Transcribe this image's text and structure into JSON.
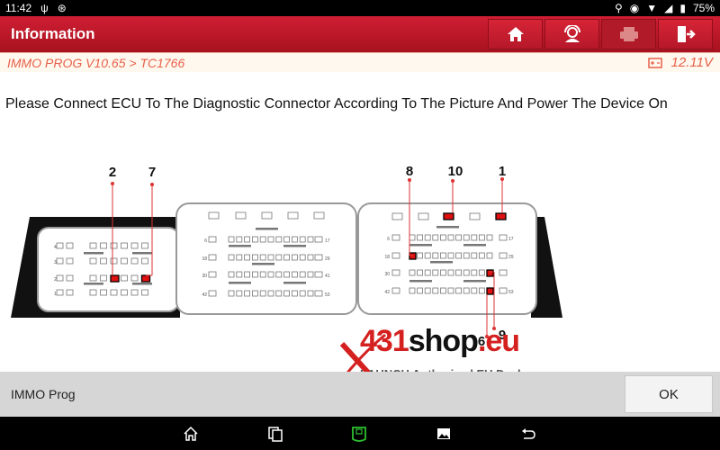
{
  "statusbar": {
    "time": "11:42",
    "battery": "75%"
  },
  "appbar": {
    "title": "Information",
    "buttons": [
      {
        "icon": "home-icon"
      },
      {
        "icon": "support-agent-icon"
      },
      {
        "icon": "printer-icon"
      },
      {
        "icon": "exit-icon"
      }
    ]
  },
  "breadcrumb": {
    "path": "IMMO PROG V10.65 > TC1766",
    "voltage": "12.11V"
  },
  "instruction": "Please Connect ECU To The Diagnostic Connector According To The Picture And Power The Device On",
  "diagram": {
    "pin_labels": [
      "2",
      "7",
      "8",
      "10",
      "1",
      "6",
      "9"
    ],
    "left_row_numbers": [
      "4",
      "3",
      "2",
      "1"
    ],
    "mid_row_left": [
      "6",
      "18",
      "30",
      "42"
    ],
    "mid_row_right": [
      "17",
      "29",
      "41",
      "53"
    ],
    "right_row_left": [
      "6",
      "18",
      "30",
      "42"
    ],
    "right_row_right": [
      "17",
      "29",
      "",
      "53"
    ]
  },
  "watermark": {
    "brand_x": "X",
    "brand_num": "431",
    "brand_shop": "shop",
    "brand_tld": ".eu",
    "tagline": "LAUNCH Authorized EU Dealer"
  },
  "footer": {
    "label": "IMMO Prog",
    "ok": "OK"
  },
  "navbar": {
    "items": [
      "home",
      "recents",
      "vci",
      "gallery",
      "back"
    ]
  }
}
